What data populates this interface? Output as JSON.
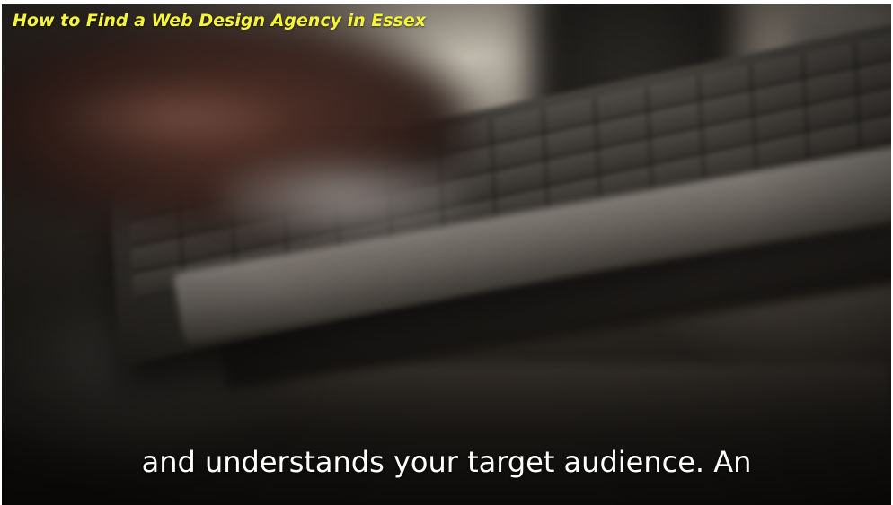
{
  "video": {
    "title": "How to Find a Web Design Agency in Essex",
    "title_color": "#f5f53a",
    "caption": "and understands your target audience. An",
    "caption_color": "#ffffff"
  }
}
